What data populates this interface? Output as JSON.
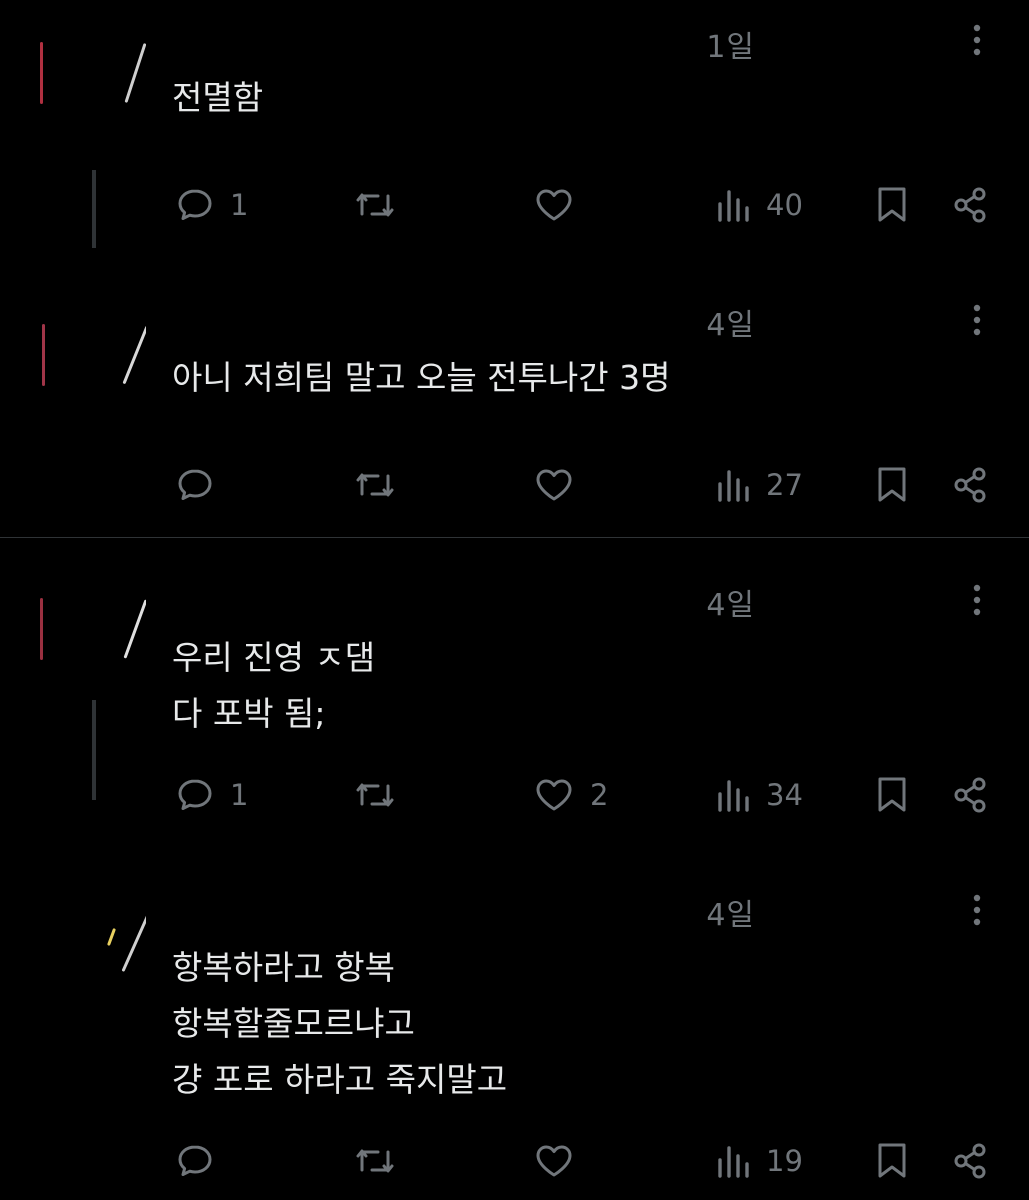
{
  "colors": {
    "background": "#000000",
    "text": "#e7e9ea",
    "muted": "#71767b",
    "divider": "#2f3336"
  },
  "posts": [
    {
      "time": "1일",
      "text": "전멸함",
      "replies": "1",
      "reposts": "",
      "likes": "",
      "views": "40"
    },
    {
      "time": "4일",
      "text": "아니 저희팀 말고 오늘 전투나간 3명",
      "replies": "",
      "reposts": "",
      "likes": "",
      "views": "27"
    },
    {
      "time": "4일",
      "text": "우리 진영 ㅈ댐\n다 포박 됨;",
      "replies": "1",
      "reposts": "",
      "likes": "2",
      "views": "34"
    },
    {
      "time": "4일",
      "text": "항복하라고 항복\n항복할줄모르냐고\n걍 포로 하라고 죽지말고",
      "replies": "",
      "reposts": "",
      "likes": "",
      "views": "19"
    }
  ],
  "icons": {
    "reply": "reply-icon",
    "repost": "repost-icon",
    "like": "heart-icon",
    "views": "views-icon",
    "bookmark": "bookmark-icon",
    "share": "share-icon",
    "more": "more-icon"
  }
}
